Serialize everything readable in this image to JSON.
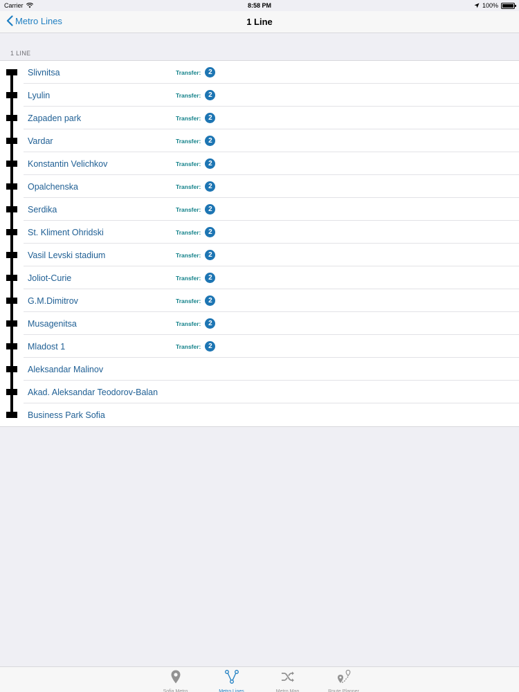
{
  "status_bar": {
    "carrier": "Carrier",
    "time": "8:58 PM",
    "battery": "100%"
  },
  "nav": {
    "back_label": "Metro Lines",
    "title": "1 Line"
  },
  "section": {
    "header": "1 LINE"
  },
  "transfer_label": "Transfer:",
  "stations": [
    {
      "name": "Slivnitsa",
      "transfer": "2"
    },
    {
      "name": "Lyulin",
      "transfer": "2"
    },
    {
      "name": "Zapaden park",
      "transfer": "2"
    },
    {
      "name": "Vardar",
      "transfer": "2"
    },
    {
      "name": "Konstantin Velichkov",
      "transfer": "2"
    },
    {
      "name": "Opalchenska",
      "transfer": "2"
    },
    {
      "name": "Serdika",
      "transfer": "2"
    },
    {
      "name": "St. Kliment Ohridski",
      "transfer": "2"
    },
    {
      "name": "Vasil Levski stadium",
      "transfer": "2"
    },
    {
      "name": "Joliot-Curie",
      "transfer": "2"
    },
    {
      "name": "G.M.Dimitrov",
      "transfer": "2"
    },
    {
      "name": "Musagenitsa",
      "transfer": "2"
    },
    {
      "name": "Mladost 1",
      "transfer": "2"
    },
    {
      "name": "Aleksandar Malinov",
      "transfer": null
    },
    {
      "name": "Akad. Aleksandar Teodorov-Balan",
      "transfer": null
    },
    {
      "name": "Business Park Sofia",
      "transfer": null
    }
  ],
  "tabs": [
    {
      "label": "Sofia Metro",
      "icon": "map-pin-icon",
      "active": false
    },
    {
      "label": "Metro Lines",
      "icon": "metro-lines-icon",
      "active": true
    },
    {
      "label": "Metro Map",
      "icon": "shuffle-icon",
      "active": false
    },
    {
      "label": "Route Planner",
      "icon": "route-planner-icon",
      "active": false
    }
  ],
  "colors": {
    "accent": "#1f7fc2",
    "transfer_text": "#14828a",
    "line_badge": "#1d75b3",
    "inactive_tab": "#929292"
  }
}
